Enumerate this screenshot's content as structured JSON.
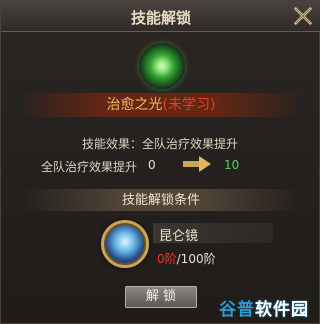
{
  "dialog": {
    "title": "技能解锁"
  },
  "skill": {
    "name": "治愈之光",
    "status": "(未学习)",
    "effect": "技能效果：全队治疗效果提升",
    "stat_label": "全队治疗效果提升",
    "stat_from": "0",
    "stat_to": "10"
  },
  "conditions": {
    "header": "技能解锁条件",
    "item_name": "昆仑镜",
    "count_current": "0阶",
    "count_total": "/100阶"
  },
  "actions": {
    "unlock_label": "解 锁"
  },
  "watermark": {
    "part1": "谷普",
    "part2": "软件园"
  },
  "colors": {
    "skill_name": "#f2b85a",
    "status_red": "#e63b2e",
    "value_green": "#4fd64f",
    "frame_gold": "#c9a45a"
  }
}
